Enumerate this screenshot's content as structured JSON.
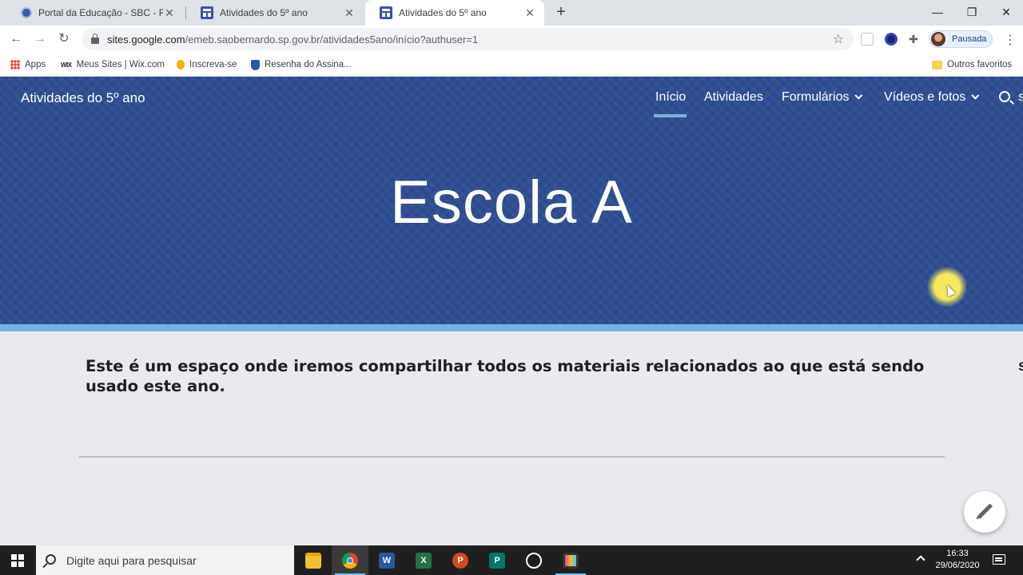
{
  "browser": {
    "tabs": [
      {
        "title": "Portal da Educação - SBC - Rede",
        "active": false
      },
      {
        "title": "Atividades do 5º ano",
        "active": false
      },
      {
        "title": "Atividades do 5º ano",
        "active": true
      }
    ],
    "new_tab_glyph": "+",
    "window_controls": {
      "minimize": "—",
      "restore": "❐",
      "close": "✕"
    },
    "nav": {
      "back": "←",
      "forward": "→",
      "reload": "↻"
    },
    "url": {
      "host": "sites.google.com",
      "path": "/emeb.saobernardo.sp.gov.br/atividades5ano/início?authuser=1"
    },
    "bookmark_star": "☆",
    "profile_label": "Pausada",
    "menu_glyph": "⋮",
    "bookmarks": [
      {
        "label": "Apps",
        "icon": "apps-grid-icon"
      },
      {
        "label": "Meus Sites | Wix.com",
        "icon": "wix-icon"
      },
      {
        "label": "Inscreva-se",
        "icon": "coin-icon"
      },
      {
        "label": "Resenha do Assina...",
        "icon": "shield-icon"
      }
    ],
    "other_bookmarks": "Outros favoritos"
  },
  "site": {
    "title": "Atividades do 5º ano",
    "nav": [
      {
        "label": "Início",
        "active": true,
        "has_dropdown": false
      },
      {
        "label": "Atividades",
        "active": false,
        "has_dropdown": false
      },
      {
        "label": "Formulários",
        "active": false,
        "has_dropdown": true
      },
      {
        "label": "Vídeos e fotos",
        "active": false,
        "has_dropdown": true
      }
    ],
    "nav_overflow_text": "s",
    "hero_heading": "Escola A",
    "intro_text": "Este é um espaço onde iremos compartilhar todos os materiais relacionados ao que está sendo usado este ano.",
    "intro_overflow_text": "s",
    "colors": {
      "hero": "#2e4f93",
      "accent": "#7ab1de",
      "background": "#e8eaed"
    }
  },
  "taskbar": {
    "search_placeholder": "Digite aqui para pesquisar",
    "apps": [
      {
        "name": "file-explorer",
        "glyph": "",
        "color": "#f2c12e",
        "running": false
      },
      {
        "name": "chrome",
        "glyph": "",
        "color": "#4285f4",
        "running": true
      },
      {
        "name": "word",
        "glyph": "W",
        "color": "#2b579a",
        "running": false
      },
      {
        "name": "excel",
        "glyph": "X",
        "color": "#217346",
        "running": false
      },
      {
        "name": "powerpoint",
        "glyph": "P",
        "color": "#d24726",
        "running": false
      },
      {
        "name": "publisher",
        "glyph": "P",
        "color": "#077568",
        "running": false
      },
      {
        "name": "photos",
        "glyph": "",
        "color": "#1f1f1f",
        "running": false
      },
      {
        "name": "screen-recorder",
        "glyph": "",
        "color": "#e04a7a",
        "running": true
      }
    ],
    "time": "16:33",
    "date": "29/06/2020"
  }
}
